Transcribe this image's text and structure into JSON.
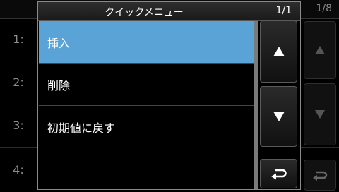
{
  "background": {
    "rows": [
      {
        "label": "1:"
      },
      {
        "label": "2:"
      },
      {
        "label": "3:"
      },
      {
        "label": "4:"
      }
    ],
    "page_indicator": "1/8"
  },
  "dialog": {
    "title": "クイックメニュー",
    "page": "1/1",
    "items": [
      {
        "label": "挿入",
        "selected": true
      },
      {
        "label": "削除",
        "selected": false
      },
      {
        "label": "初期値に戻す",
        "selected": false
      },
      {
        "label": "",
        "selected": false
      }
    ]
  },
  "buttons": {
    "up_icon": "triangle-up",
    "down_icon": "triangle-down",
    "back_icon": "return-arrow"
  },
  "colors": {
    "selected_bg": "#5aa3d6"
  }
}
